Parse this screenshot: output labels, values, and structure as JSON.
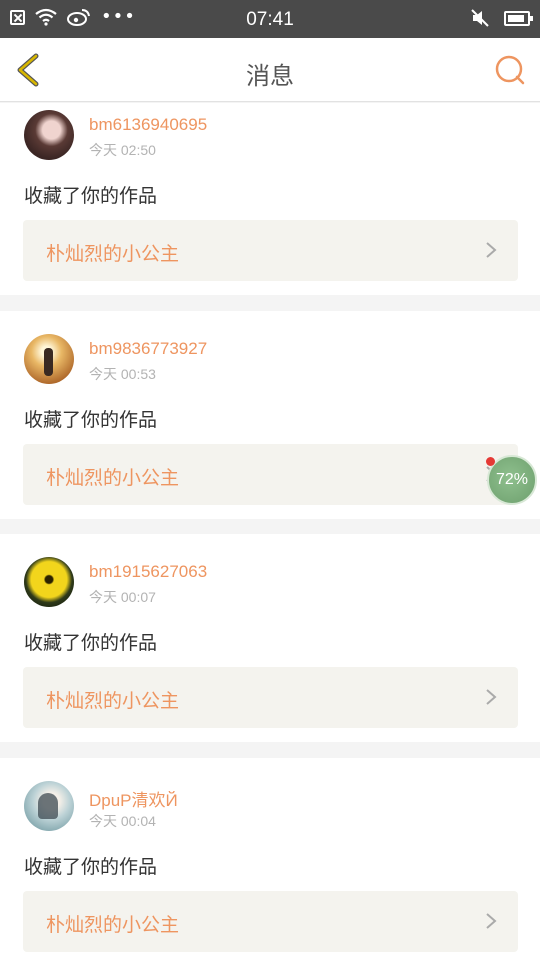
{
  "status_bar": {
    "time": "07:41",
    "icons": [
      "close-notification-icon",
      "wifi-icon",
      "weibo-icon",
      "more-dots-icon",
      "mute-icon",
      "battery-icon"
    ],
    "dots": "•••"
  },
  "nav": {
    "title": "消息",
    "back_icon": "chevron-left-icon",
    "search_icon": "search-icon"
  },
  "messages": [
    {
      "username": "bm6136940695",
      "time": "今天 02:50",
      "action": "收藏了你的作品",
      "work_title": "朴灿烈的小公主"
    },
    {
      "username": "bm9836773927",
      "time": "今天 00:53",
      "action": "收藏了你的作品",
      "work_title": "朴灿烈的小公主"
    },
    {
      "username": "bm1915627063",
      "time": "今天 00:07",
      "action": "收藏了你的作品",
      "work_title": "朴灿烈的小公主"
    },
    {
      "username": "DpuP清欢Й",
      "time": "今天 00:04",
      "action": "收藏了你的作品",
      "work_title": "朴灿烈的小公主"
    }
  ],
  "floating_widget": {
    "label": "72%"
  },
  "colors": {
    "accent": "#ee9560",
    "status_bar_bg": "#4a4a4a",
    "link_bg": "#f4f3ee",
    "back_icon": "#c9a800"
  }
}
